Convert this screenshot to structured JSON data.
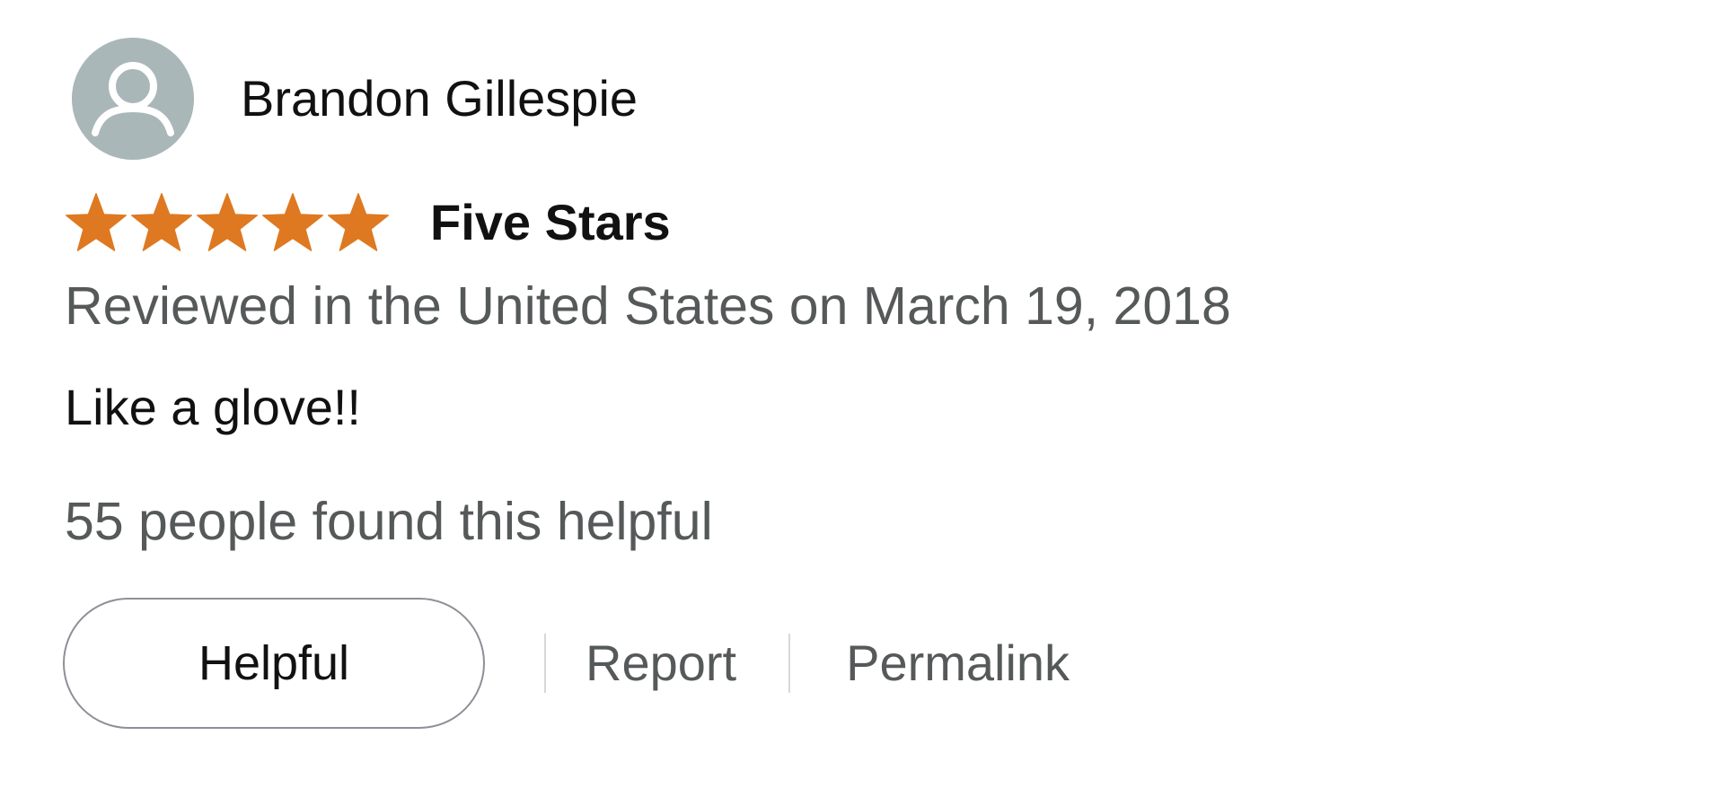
{
  "reviewer": {
    "name": "Brandon Gillespie",
    "avatar_icon": "default-profile-icon"
  },
  "review": {
    "rating": 5,
    "max_rating": 5,
    "star_color": "#de7921",
    "title": "Five Stars",
    "date_line": "Reviewed in the United States on March 19, 2018",
    "body": "Like a glove!!",
    "helpful_count_text": "55 people found this helpful"
  },
  "actions": {
    "helpful_label": "Helpful",
    "report_label": "Report",
    "permalink_label": "Permalink"
  }
}
